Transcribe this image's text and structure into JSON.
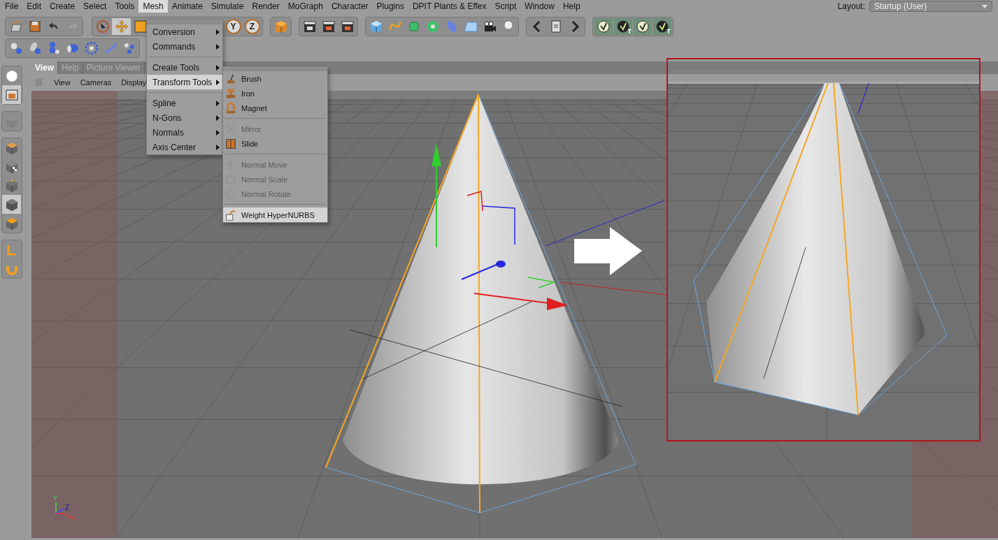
{
  "menubar": {
    "items": [
      {
        "label": "File",
        "selected": false
      },
      {
        "label": "Edit",
        "selected": false
      },
      {
        "label": "Create",
        "selected": false
      },
      {
        "label": "Select",
        "selected": false
      },
      {
        "label": "Tools",
        "selected": false
      },
      {
        "label": "Mesh",
        "selected": true
      },
      {
        "label": "Animate",
        "selected": false
      },
      {
        "label": "Simulate",
        "selected": false
      },
      {
        "label": "Render",
        "selected": false
      },
      {
        "label": "MoGraph",
        "selected": false
      },
      {
        "label": "Character",
        "selected": false
      },
      {
        "label": "Plugins",
        "selected": false
      },
      {
        "label": "DPIT Plants & Effex",
        "selected": false
      },
      {
        "label": "Script",
        "selected": false
      },
      {
        "label": "Window",
        "selected": false
      },
      {
        "label": "Help",
        "selected": false
      }
    ],
    "layout_label": "Layout:",
    "layout_value": "Startup (User)"
  },
  "toolbar": {
    "axis_buttons": [
      "Y",
      "Z"
    ],
    "plugin_buttons": [
      {
        "kind": "plain"
      },
      {
        "kind": "badged",
        "badge": "T"
      },
      {
        "kind": "plain"
      },
      {
        "kind": "badged",
        "badge": "T"
      }
    ]
  },
  "panel": {
    "tabs": [
      {
        "label": "View",
        "selected": true
      },
      {
        "label": "Help",
        "selected": false
      },
      {
        "label": "Picture Viewer",
        "selected": false
      }
    ],
    "view_menu": [
      "View",
      "Cameras",
      "Display"
    ]
  },
  "viewport": {
    "axis_labels": [
      "Y",
      "Z",
      "X"
    ]
  },
  "mesh_menu": {
    "groups": [
      [
        {
          "label": "Conversion",
          "selected": false
        },
        {
          "label": "Commands",
          "selected": false
        }
      ],
      [
        {
          "label": "Create Tools",
          "selected": false
        },
        {
          "label": "Transform Tools",
          "selected": true
        }
      ],
      [
        {
          "label": "Spline",
          "selected": false
        },
        {
          "label": "N-Gons",
          "selected": false
        },
        {
          "label": "Normals",
          "selected": false
        },
        {
          "label": "Axis Center",
          "selected": false
        }
      ]
    ]
  },
  "transform_submenu": {
    "groups": [
      [
        {
          "label": "Brush",
          "disabled": false,
          "selected": false
        },
        {
          "label": "Iron",
          "disabled": false,
          "selected": false
        },
        {
          "label": "Magnet",
          "disabled": false,
          "selected": false
        }
      ],
      [
        {
          "label": "Mirror",
          "disabled": true,
          "selected": false
        },
        {
          "label": "Slide",
          "disabled": false,
          "selected": false
        }
      ],
      [
        {
          "label": "Normal Move",
          "disabled": true,
          "selected": false
        },
        {
          "label": "Normal Scale",
          "disabled": true,
          "selected": false
        },
        {
          "label": "Normal Rotate",
          "disabled": true,
          "selected": false
        }
      ],
      [
        {
          "label": "Weight HyperNURBS",
          "disabled": false,
          "selected": true
        }
      ]
    ]
  }
}
